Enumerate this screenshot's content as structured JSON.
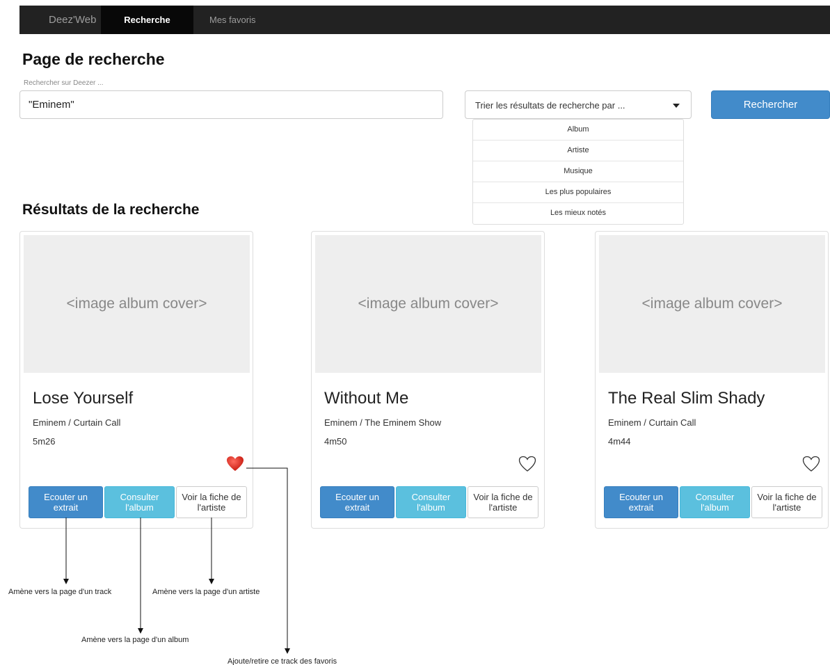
{
  "navbar": {
    "brand": "Deez'Web",
    "items": [
      {
        "label": "Recherche",
        "active": true
      },
      {
        "label": "Mes favoris",
        "active": false
      }
    ],
    "background": "#222222"
  },
  "search": {
    "page_title": "Page de recherche",
    "label": "Rechercher sur Deezer ...",
    "value": "\"Eminem\"",
    "sort_placeholder": "Trier les résultats de recherche par ...",
    "sort_options": [
      "Album",
      "Artiste",
      "Musique",
      "Les plus populaires",
      "Les mieux notés"
    ],
    "button_label": "Rechercher"
  },
  "results": {
    "title": "Résultats de la recherche",
    "cards": [
      {
        "cover_placeholder": "<image album cover>",
        "title": "Lose Yourself",
        "subtitle": "Eminem / Curtain Call",
        "duration": "5m26",
        "favorite": true,
        "buttons": {
          "listen": "Ecouter un extrait",
          "album": "Consulter l'album",
          "artist": "Voir la fiche de l'artiste"
        }
      },
      {
        "cover_placeholder": "<image album cover>",
        "title": "Without Me",
        "subtitle": "Eminem / The Eminem Show",
        "duration": "4m50",
        "favorite": false,
        "buttons": {
          "listen": "Ecouter un extrait",
          "album": "Consulter l'album",
          "artist": "Voir la fiche de l'artiste"
        }
      },
      {
        "cover_placeholder": "<image album cover>",
        "title": "The Real Slim Shady",
        "subtitle": "Eminem / Curtain Call",
        "duration": "4m44",
        "favorite": false,
        "buttons": {
          "listen": "Ecouter un extrait",
          "album": "Consulter l'album",
          "artist": "Voir la fiche de l'artiste"
        }
      }
    ]
  },
  "annotations": {
    "track": "Amène vers la page d'un track",
    "artist": "Amène vers la page d'un artiste",
    "album": "Amène vers la page d'un album",
    "favorite": "Ajoute/retire ce track des favoris"
  },
  "colors": {
    "primary": "#428bca",
    "info": "#5bc0de",
    "heart": "#d9261c"
  },
  "icons": {
    "favorite_on": "heart-filled-icon",
    "favorite_off": "heart-outline-icon"
  }
}
